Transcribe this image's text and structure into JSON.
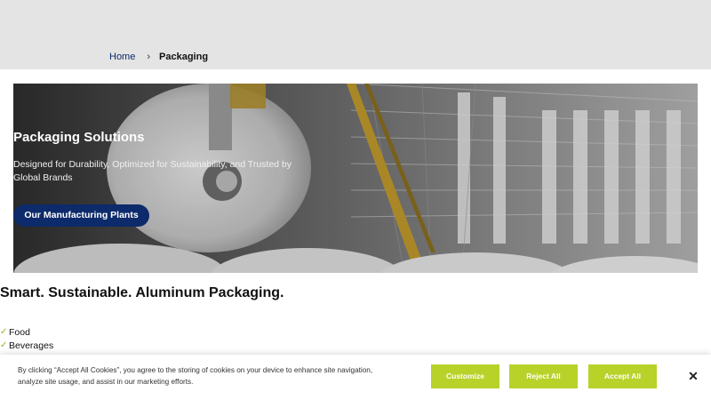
{
  "breadcrumb": {
    "home": "Home",
    "separator": "›",
    "current": "Packaging"
  },
  "hero": {
    "title": "Packaging Solutions",
    "subtitle": "Designed for Durability, Optimized for Sustainability, and Trusted by Global Brands",
    "button_label": "Our Manufacturing Plants"
  },
  "section": {
    "title": "Smart. Sustainable. Aluminum Packaging.",
    "items": [
      {
        "icon": "check-icon",
        "mark": "✓",
        "label": "Food"
      },
      {
        "icon": "check-icon",
        "mark": "✓",
        "label": "Beverages"
      }
    ]
  },
  "cookie": {
    "text": "By clicking “Accept All Cookies”, you agree to the storing of cookies on your device to enhance site navigation, analyze site usage, and assist in our marketing efforts.",
    "customize_label": "Customize",
    "reject_label": "Reject All",
    "accept_label": "Accept All",
    "close_icon": "close-icon",
    "close_glyph": "✕"
  },
  "colors": {
    "navy": "#0d2a6b",
    "accent_green": "#b8d22a",
    "check_green": "#8cb81f",
    "topbar_gray": "#e4e4e4"
  }
}
